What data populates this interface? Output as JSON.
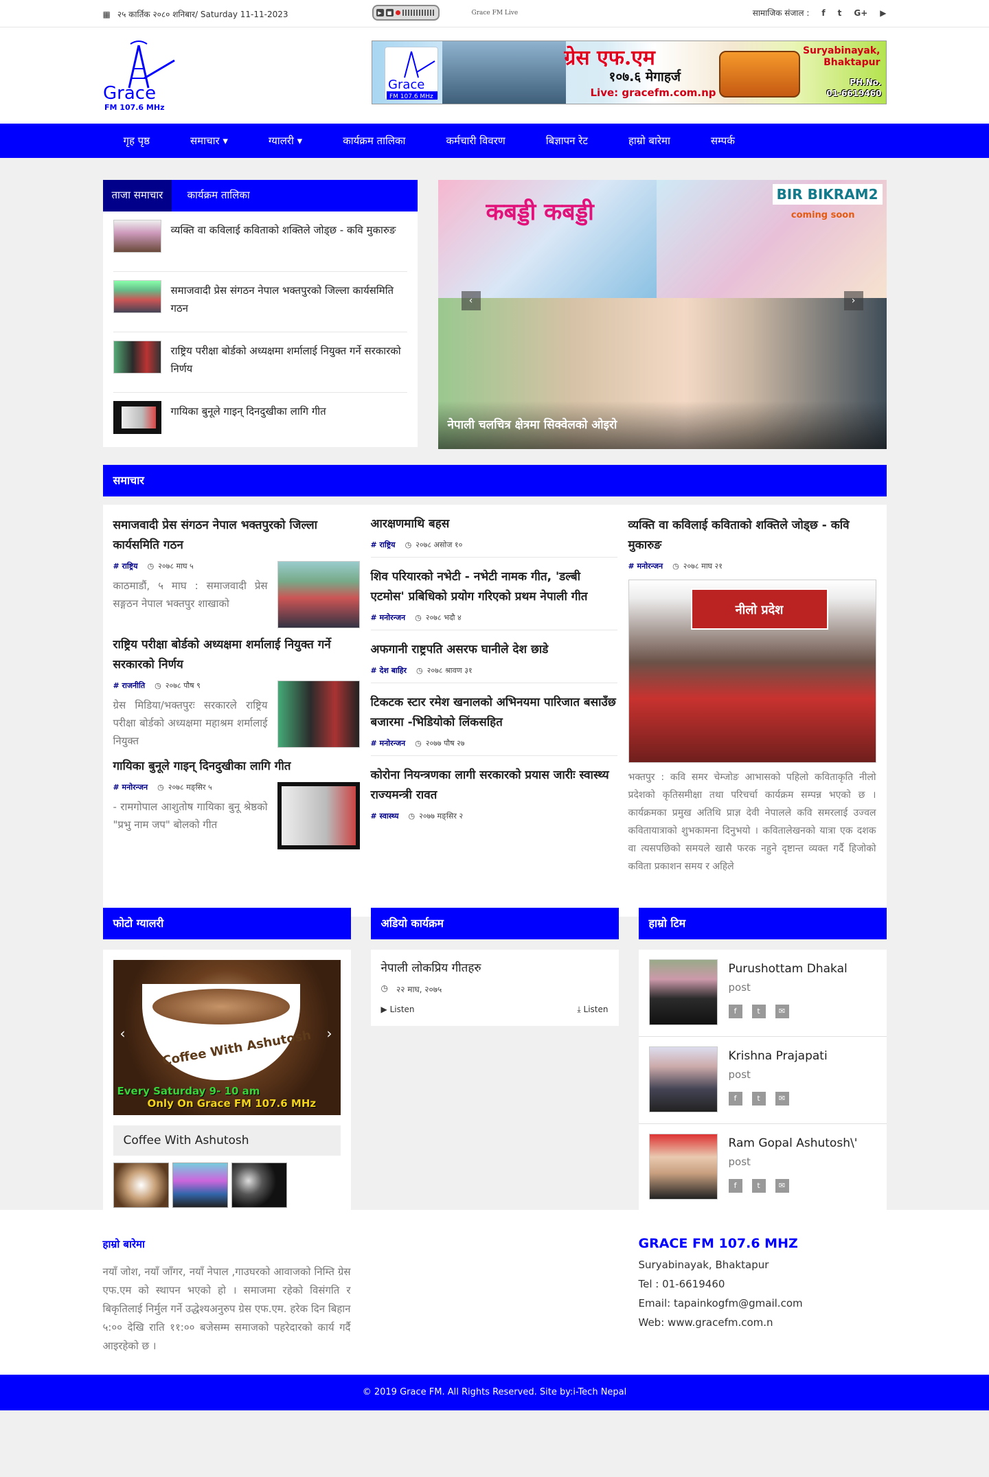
{
  "topbar": {
    "date": "२५ कार्तिक २०८० शनिबार/ Saturday 11-11-2023",
    "live_label": "Grace FM Live",
    "social_label": "सामाजिक संजाल :"
  },
  "header": {
    "logo_text": "Grace",
    "logo_sub": "FM 107.6 MHz",
    "banner": {
      "title": "ग्रेस एफ.एम",
      "subtitle": "१०७.६ मेगाहर्ज",
      "web": "Live: gracefm.com.np",
      "location": "Suryabinayak, Bhaktapur",
      "phone_label": "PH.No.",
      "phone": "01-6619460",
      "logo_text": "Grace",
      "logo_sub": "FM 107.6 MHz"
    }
  },
  "nav": {
    "items": [
      {
        "label": "गृह पृष्ठ"
      },
      {
        "label": "समाचार ▾"
      },
      {
        "label": "ग्यालरी ▾"
      },
      {
        "label": "कार्यक्रम तालिका"
      },
      {
        "label": "कर्मचारी विवरण"
      },
      {
        "label": "बिज्ञापन रेट"
      },
      {
        "label": "हाम्रो बारेमा"
      },
      {
        "label": "सम्पर्क"
      }
    ]
  },
  "latest": {
    "tabs": [
      "ताजा समाचार",
      "कार्यक्रम तालिका"
    ],
    "items": [
      {
        "title": "व्यक्ति वा कविलाई कविताको शक्तिले जोड्छ - कवि मुकारुङ"
      },
      {
        "title": "समाजवादी प्रेस संगठन नेपाल भक्तपुरको जिल्ला कार्यसमिति गठन"
      },
      {
        "title": "राष्ट्रिय परीक्षा बोर्डको अध्यक्षमा  शर्मालाई नियुक्त गर्ने सरकारको निर्णय"
      },
      {
        "title": "गायिका बुनूले गाइन् दिनदुखीका लागि गीत"
      }
    ]
  },
  "slider": {
    "poster1_title": "कबड्डी कबड्डी",
    "poster2_title": "BIR BIKRAM2",
    "poster2_sub": "coming soon",
    "caption": "नेपाली चलचित्र क्षेत्रमा सिक्वेलको ओइरो",
    "prev": "‹",
    "next": "›"
  },
  "samachar": {
    "heading": "समाचार",
    "col1": [
      {
        "title": "समाजवादी प्रेस संगठन नेपाल भक्तपुरको जिल्ला कार्यसमिति गठन",
        "tag": "# राष्ट्रिय",
        "date": "२०७८ माघ ५",
        "excerpt": "काठमाडौं, ५ माघ : समाजवादी प्रेस सङ्गठन नेपाल भक्तपुर शाखाको"
      },
      {
        "title": "राष्ट्रिय परीक्षा बोर्डको अध्यक्षमा  शर्मालाई नियुक्त गर्ने सरकारको निर्णय",
        "tag": "# राजनीति",
        "date": "२०७८ पौष ९",
        "excerpt": "ग्रेस मिडिया/भक्तपुरः सरकारले राष्ट्रिय परीक्षा बोर्डको अध्यक्षमा महाश्रम शर्मालाई नियुक्त"
      },
      {
        "title": "गायिका बुनूले गाइन् दिनदुखीका लागि गीत",
        "tag": "# मनोरन्जन",
        "date": "२०७८ मङ्सिर ५",
        "excerpt": "- रामगोपाल आशुतोष    गायिका बुनू श्रेष्ठको \"प्रभु नाम जप\" बोलको गीत"
      }
    ],
    "col2": [
      {
        "title": "आरक्षणमाथि बहस",
        "tag": "# राष्ट्रिय",
        "date": "२०७८ असोज १०"
      },
      {
        "title": "शिव परियारको नभेटी - नभेटी नामक गीत, 'डल्बी एटमोस' प्रबिधिको प्रयोग गरिएको प्रथम नेपाली गीत",
        "tag": "# मनोरन्जन",
        "date": "२०७८ भदौ ४"
      },
      {
        "title": "अफगानी राष्ट्रपति असरफ घानीले देश छाडे",
        "tag": "# देश बाहिर",
        "date": "२०७८ श्रावण ३१"
      },
      {
        "title": "टिकटक स्टार रमेश खनालको अभिनयमा  पारिजात बसाउँछ बजारमा -भिडियोको लिंकसहित",
        "tag": "# मनोरन्जन",
        "date": "२०७७ पौष २७"
      },
      {
        "title": "कोरोना नियन्त्रणका लागी सरकारको प्रयास जारीः स्वास्थ्य राज्यमन्त्री रावत",
        "tag": "# स्वास्थ्य",
        "date": "२०७७ मङ्सिर २"
      }
    ],
    "col3": {
      "title": "व्यक्ति वा कविलाई कविताको शक्तिले जोड्छ - कवि मुकारुङ",
      "tag": "# मनोरन्जन",
      "date": "२०७८ माघ २१",
      "pic_banner": "नीलो प्रदेश",
      "excerpt": "भक्तपुर :   कवि समर चेम्जोङ आभासको पहिलो कविताकृति नीलो प्रदेशको कृतिसमीक्षा तथा परिचर्चा कार्यक्रम सम्पन्न भएको छ । कार्यक्रमका प्रमुख अतिथि प्राज्ञ देवी नेपालले कवि समरलाई उज्वल कवितायात्राको शुभकामना दिनुभयो । कवितालेखनको यात्रा एक दशक वा त्यसपछिको समयले खासै फरक नहुने दृष्टान्त व्यक्त गर्दै हिजोको कविता प्रकाशन समय र अहिले"
    }
  },
  "gallery": {
    "heading": "फोटो ग्यालरी",
    "caption": "Coffee With Ashutosh",
    "img_title": "Coffee With Ashutosh",
    "img_line1": "Every Saturday 9- 10 am",
    "img_line2": "Only On Grace FM 107.6 MHz"
  },
  "audio": {
    "heading": "अडियो कार्यक्रम",
    "title": "नेपाली लोकप्रिय गीतहरु",
    "date": "२२ माघ, २०७५",
    "listen": "Listen",
    "download": "Listen"
  },
  "team": {
    "heading": "हाम्रो टिम",
    "members": [
      {
        "name": "Purushottam Dhakal",
        "post": "post"
      },
      {
        "name": "Krishna Prajapati",
        "post": "post"
      },
      {
        "name": "Ram Gopal Ashutosh\\'",
        "post": "post"
      }
    ]
  },
  "footer": {
    "about_heading": "हाम्रो बारेमा",
    "about_text": "नयाँ जोश, नयाँ जाँगर, नयाँ नेपाल ,गाउघरको आवाजको निम्ति ग्रेस एफ.एम को स्थापन भएको हो । समाजमा रहेको विसंगति र बिकृतिलाई निर्मुल गर्ने उद्धेश्यअनुरुप ग्रेस एफ.एम. हरेक दिन बिहान ५:०० देखि राति ११:०० बजेसम्म समाजको पहरेदारको कार्य गर्दै आइरहेको छ ।",
    "contact_heading": "GRACE FM 107.6 MHZ",
    "address": "Suryabinayak, Bhaktapur",
    "tel": "Tel : 01-6619460",
    "email": "Email: tapainkogfm@gmail.com",
    "web": "Web: www.gracefm.com.n",
    "copyright": "© 2019 Grace FM. All Rights Reserved. Site by:i-Tech Nepal"
  },
  "colors": {
    "primary": "#0000ff",
    "dark_tab": "#00008b"
  }
}
